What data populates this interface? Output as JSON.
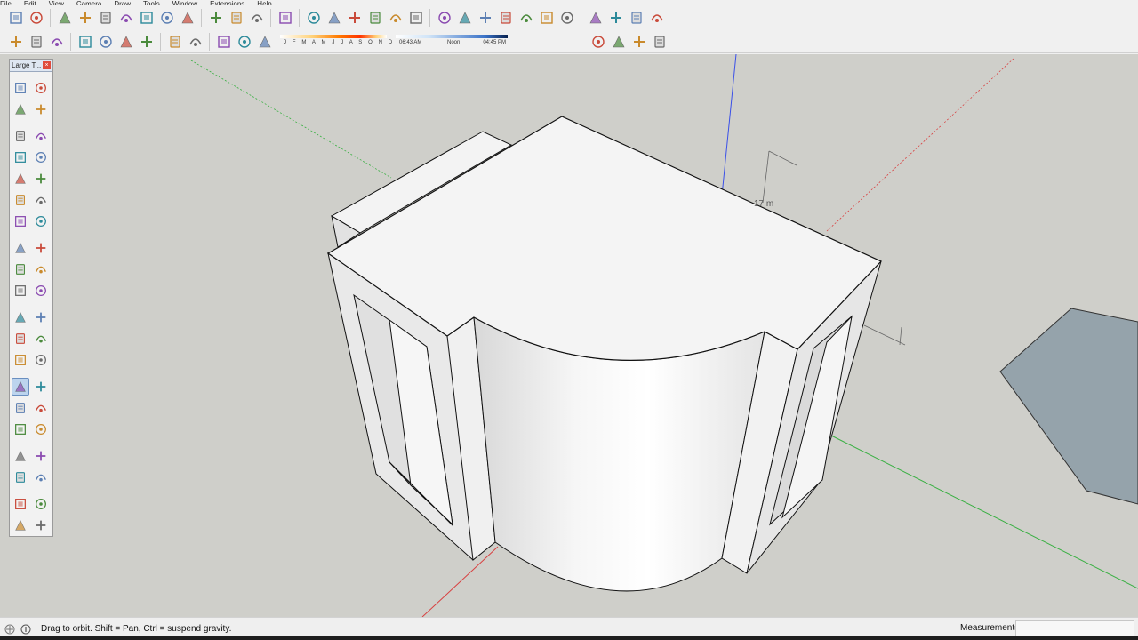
{
  "menu": [
    "File",
    "Edit",
    "View",
    "Camera",
    "Draw",
    "Tools",
    "Window",
    "Extensions",
    "Help"
  ],
  "toolbar_top": {
    "icons": [
      "get-models-icon",
      "share-model-icon",
      "iso-view-icon",
      "top-view-icon",
      "front-view-icon",
      "right-view-icon",
      "back-view-icon",
      "left-view-icon",
      "bottom-view-icon",
      "orbit-icon",
      "pan-icon",
      "zoom-icon",
      "section-plane-icon",
      "xray-icon",
      "wireframe-icon",
      "hidden-line-icon",
      "shaded-icon",
      "shaded-texture-icon",
      "monochrome-icon",
      "push-pull-icon",
      "follow-me-icon",
      "offset-icon",
      "protractor-icon",
      "axes-icon",
      "circle-icon",
      "arc-icon",
      "camera-position-icon",
      "walk-icon",
      "look-around-icon",
      "position-camera-icon"
    ]
  },
  "toolbar_bottom": {
    "icons": [
      "add-location-icon",
      "open-icon",
      "save-icon",
      "cut-icon",
      "copy-icon",
      "paste-icon",
      "erase-icon",
      "undo-icon",
      "redo-icon",
      "print-icon",
      "model-info-icon",
      "shadows-toggle-icon"
    ],
    "months_label": "J F M A M J J A S O N D",
    "time_start": "06:43 AM",
    "time_mid": "Noon",
    "time_end": "04:45 PM",
    "right_icons": [
      "extension-warehouse-icon",
      "extension-manager-icon",
      "components-icon",
      "styles-icon"
    ]
  },
  "palette": {
    "title": "Large T...",
    "close": "×",
    "tools": [
      "select-icon",
      "make-component-icon",
      "paint-bucket-icon",
      "eraser-icon",
      "line-icon",
      "freehand-icon",
      "rectangle-icon",
      "rotated-rectangle-icon",
      "circle-icon",
      "polygon-icon",
      "arc-icon",
      "two-point-arc-icon",
      "three-point-arc-icon",
      "pie-icon",
      "move-icon",
      "push-pull-icon",
      "rotate-icon",
      "follow-me-icon",
      "scale-icon",
      "offset-icon",
      "tape-measure-icon",
      "dimension-icon",
      "protractor-icon",
      "text-icon",
      "axes-icon",
      "3d-text-icon",
      "orbit-icon",
      "pan-icon",
      "zoom-icon",
      "zoom-window-icon",
      "zoom-extents-icon",
      "previous-view-icon",
      "position-camera-icon",
      "look-around-icon",
      "walk-icon",
      "section-plane-icon",
      "3d-warehouse-icon",
      "extension-warehouse-icon",
      "share-model-icon",
      "extension-manager-icon"
    ],
    "active": "orbit-icon"
  },
  "viewport": {
    "dimension_label": "17 m",
    "axis_colors": {
      "blue": "#3a50e8",
      "red": "#d84040",
      "green": "#3ab043"
    },
    "background": "#cfcfca"
  },
  "status": {
    "message": "Drag to orbit. Shift = Pan, Ctrl = suspend gravity.",
    "measurements_label": "Measurements",
    "measurements_value": ""
  }
}
